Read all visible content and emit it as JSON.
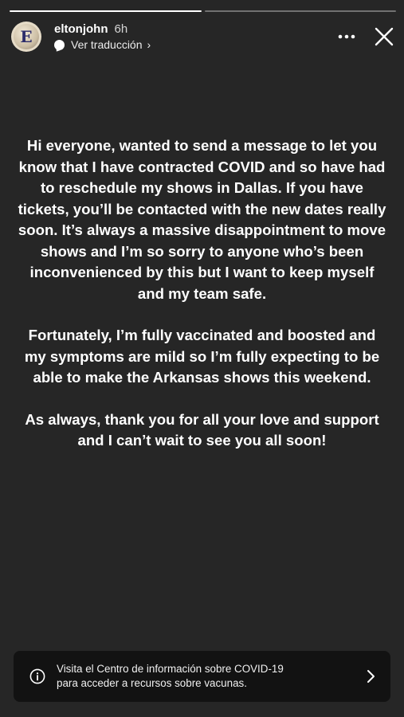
{
  "story": {
    "progress": [
      1.0,
      0.0
    ],
    "username": "eltonjohn",
    "time_ago": "6h",
    "translate_label": "Ver traducción",
    "avatar_letter": "E",
    "paragraphs": [
      "Hi everyone, wanted to send a message to let you know that I have contracted COVID and so have had to reschedule my shows in Dallas. If you have tickets, you’ll be contacted with the new dates really soon. It’s always a massive disappointment to move shows and I’m so sorry to anyone who’s been inconvenienced by this but I want to keep myself and my team safe.",
      "Fortunately, I’m fully vaccinated and boosted and my symptoms are mild so I’m fully expecting to be able to make the Arkansas shows this weekend.",
      "As always, thank you for all your love and support and I can’t wait to see you all soon!"
    ]
  },
  "banner": {
    "line1": "Visita el Centro de información sobre COVID-19",
    "line2": "para acceder a recursos sobre vacunas."
  },
  "icons": {
    "more": "more-horizontal-icon",
    "close": "close-icon",
    "info": "info-icon",
    "chevron": "chevron-right-icon",
    "translate": "speech-bubble-icon"
  },
  "colors": {
    "background": "#262626",
    "banner": "#121212",
    "text": "#ffffff"
  }
}
